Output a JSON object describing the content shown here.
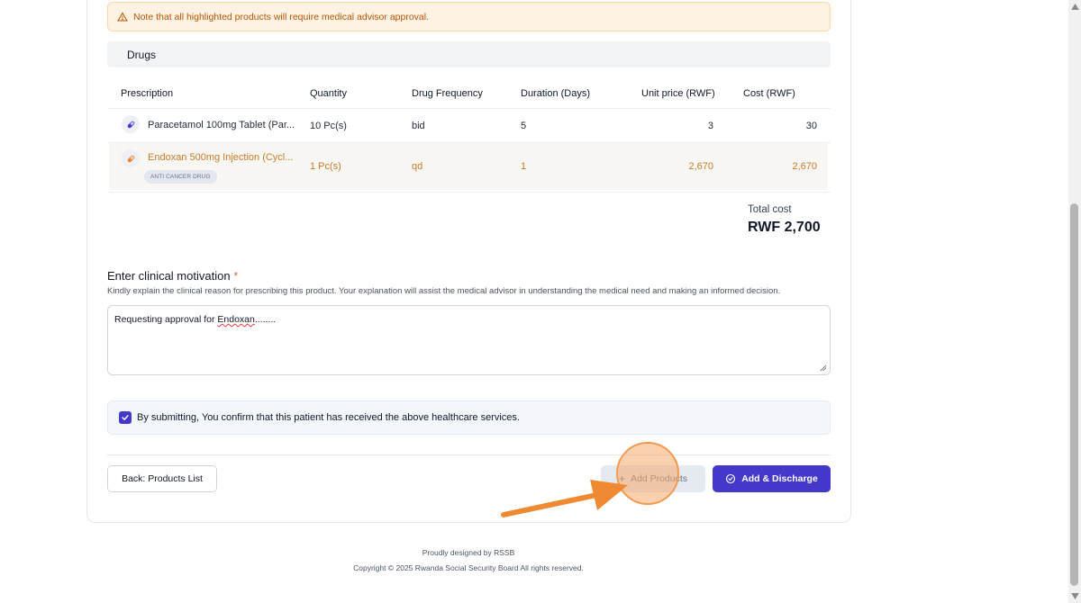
{
  "warning": {
    "text": "Note that all highlighted products will require medical advisor approval."
  },
  "drugs_section": {
    "title": "Drugs"
  },
  "table": {
    "headers": [
      "Prescription",
      "Quantity",
      "Drug Frequency",
      "Duration (Days)",
      "Unit price (RWF)",
      "Cost (RWF)"
    ],
    "rows": [
      {
        "name": "Paracetamol 100mg Tablet (Par...",
        "quantity": "10 Pc(s)",
        "frequency": "bid",
        "duration": "5",
        "unit_price": "3",
        "cost": "30",
        "tag": "",
        "highlighted": false
      },
      {
        "name": "Endoxan 500mg Injection (Cycl...",
        "quantity": "1 Pc(s)",
        "frequency": "qd",
        "duration": "1",
        "unit_price": "2,670",
        "cost": "2,670",
        "tag": "ANTI CANCER DRUG",
        "highlighted": true
      }
    ]
  },
  "total": {
    "label": "Total cost",
    "value": "RWF 2,700"
  },
  "motivation": {
    "title": "Enter clinical motivation",
    "required_mark": "*",
    "description": "Kindly explain the clinical reason for prescribing this product. Your explanation will assist the medical advisor in understanding the medical need and making an informed decision.",
    "value_prefix": "Requesting approval for ",
    "value_misspelled": "Endoxan",
    "value_suffix": "........"
  },
  "confirm": {
    "checked": true,
    "label": "By submitting, You confirm that this patient has received the above healthcare services."
  },
  "actions": {
    "back_label": "Back: Products List",
    "add_products_label": "Add Products",
    "add_discharge_label": "Add & Discharge"
  },
  "footer": {
    "line1": "Proudly designed by RSSB",
    "line2": "Copyright © 2025 Rwanda Social Security Board All rights reserved."
  },
  "colors": {
    "accent": "#4338ca",
    "warning_bg": "#fef3e2",
    "highlight_text": "#c97b2c",
    "annotation": "#f39a4f"
  },
  "icons": {
    "warning": "warning-triangle-icon",
    "pill": "pill-icon",
    "check": "check-icon",
    "plus": "plus-icon",
    "check_circle": "check-circle-icon"
  }
}
